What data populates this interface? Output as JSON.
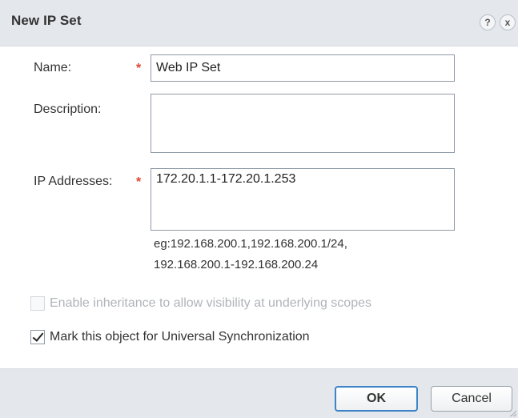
{
  "dialog": {
    "title": "New IP Set",
    "help_icon_glyph": "?",
    "close_icon_glyph": "x"
  },
  "form": {
    "name_label": "Name:",
    "name_required": "*",
    "name_value": "Web IP Set",
    "description_label": "Description:",
    "description_value": "",
    "ip_label": "IP Addresses:",
    "ip_required": "*",
    "ip_value": "172.20.1.1-172.20.1.253",
    "ip_hint_line1": "eg:192.168.200.1,192.168.200.1/24,",
    "ip_hint_line2": "192.168.200.1-192.168.200.24"
  },
  "options": {
    "inheritance_label": "Enable inheritance to allow visibility at underlying scopes",
    "inheritance_checked": false,
    "inheritance_enabled": false,
    "universal_sync_label": "Mark this object for Universal Synchronization",
    "universal_sync_checked": true
  },
  "footer": {
    "ok_label": "OK",
    "cancel_label": "Cancel"
  },
  "colors": {
    "required_marker": "#e0442e",
    "ok_border": "#3c84c7",
    "panel_background": "#e4e7ec"
  }
}
